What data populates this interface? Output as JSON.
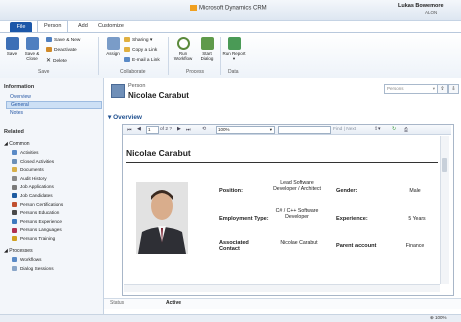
{
  "app": {
    "title": "Microsoft Dynamics CRM",
    "user_name": "Lukas Bowemore",
    "user_org": "ALON"
  },
  "tabs": {
    "file": "File",
    "person": "Person",
    "add": "Add",
    "customize": "Customize"
  },
  "ribbon": {
    "save": "Save",
    "save_close": "Save & Close",
    "save_new": "Save & New",
    "deactivate": "Deactivate",
    "delete": "Delete",
    "assign": "Assign",
    "sharing": "Sharing",
    "copy_link": "Copy a Link",
    "email_link": "E-mail a Link",
    "run_workflow": "Run Workflow",
    "start_dialog": "Start Dialog",
    "run_report": "Run Report",
    "group_save": "Save",
    "group_collaborate": "Collaborate",
    "group_process": "Process",
    "group_data": "Data",
    "colors": {
      "file_tab": "#1b57a9",
      "accent": "#1e4f8f"
    }
  },
  "left_nav": {
    "information": "Information",
    "overview": "Overview",
    "general": "General",
    "notes": "Notes",
    "related": "Related",
    "common": "Common",
    "items": [
      "Activities",
      "Closed Activities",
      "Documents",
      "Audit History",
      "Job Applications",
      "Job Candidates",
      "Person Certifications",
      "Persons Education",
      "Persons Experience",
      "Persons Languages",
      "Persons Training"
    ],
    "processes": "Processes",
    "process_items": [
      "Workflows",
      "Dialog Sessions"
    ]
  },
  "header": {
    "entity_type": "Person",
    "record_name": "Nicolae Carabut",
    "view_selector": "Persons"
  },
  "section": {
    "title": "Overview"
  },
  "report_toolbar": {
    "page": "1",
    "of_pages": "of 2 ?",
    "zoom": "100%",
    "find_label": "Find | Next"
  },
  "report": {
    "name": "Nicolae Carabut",
    "fields": {
      "position_label": "Position:",
      "position_value": "Lead Software Developer / Architect",
      "gender_label": "Gender:",
      "gender_value": "Male",
      "employment_label": "Employment Type:",
      "employment_value": "C# / C++ Software Developer",
      "experience_label": "Experience:",
      "experience_value": "5 Years",
      "associated_label": "Associated Contact",
      "associated_value": "Nicolae Carabut",
      "parent_label": "Parent account",
      "parent_value": "Finance"
    }
  },
  "status": {
    "label": "Status",
    "value": "Active"
  },
  "footer": {
    "zoom": "100%"
  }
}
